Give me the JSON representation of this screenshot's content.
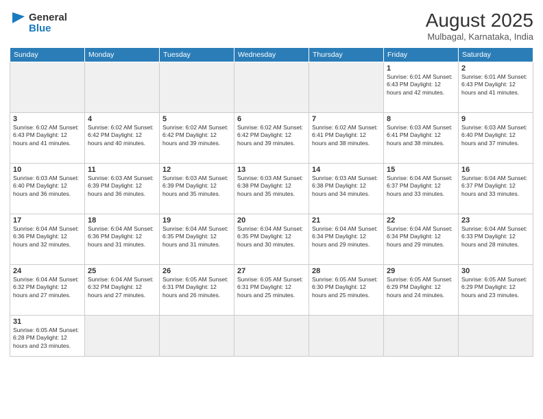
{
  "logo": {
    "text_general": "General",
    "text_blue": "Blue"
  },
  "title": {
    "month_year": "August 2025",
    "location": "Mulbagal, Karnataka, India"
  },
  "headers": [
    "Sunday",
    "Monday",
    "Tuesday",
    "Wednesday",
    "Thursday",
    "Friday",
    "Saturday"
  ],
  "weeks": [
    [
      {
        "day": "",
        "info": ""
      },
      {
        "day": "",
        "info": ""
      },
      {
        "day": "",
        "info": ""
      },
      {
        "day": "",
        "info": ""
      },
      {
        "day": "",
        "info": ""
      },
      {
        "day": "1",
        "info": "Sunrise: 6:01 AM\nSunset: 6:43 PM\nDaylight: 12 hours and 42 minutes."
      },
      {
        "day": "2",
        "info": "Sunrise: 6:01 AM\nSunset: 6:43 PM\nDaylight: 12 hours and 41 minutes."
      }
    ],
    [
      {
        "day": "3",
        "info": "Sunrise: 6:02 AM\nSunset: 6:43 PM\nDaylight: 12 hours and 41 minutes."
      },
      {
        "day": "4",
        "info": "Sunrise: 6:02 AM\nSunset: 6:42 PM\nDaylight: 12 hours and 40 minutes."
      },
      {
        "day": "5",
        "info": "Sunrise: 6:02 AM\nSunset: 6:42 PM\nDaylight: 12 hours and 39 minutes."
      },
      {
        "day": "6",
        "info": "Sunrise: 6:02 AM\nSunset: 6:42 PM\nDaylight: 12 hours and 39 minutes."
      },
      {
        "day": "7",
        "info": "Sunrise: 6:02 AM\nSunset: 6:41 PM\nDaylight: 12 hours and 38 minutes."
      },
      {
        "day": "8",
        "info": "Sunrise: 6:03 AM\nSunset: 6:41 PM\nDaylight: 12 hours and 38 minutes."
      },
      {
        "day": "9",
        "info": "Sunrise: 6:03 AM\nSunset: 6:40 PM\nDaylight: 12 hours and 37 minutes."
      }
    ],
    [
      {
        "day": "10",
        "info": "Sunrise: 6:03 AM\nSunset: 6:40 PM\nDaylight: 12 hours and 36 minutes."
      },
      {
        "day": "11",
        "info": "Sunrise: 6:03 AM\nSunset: 6:39 PM\nDaylight: 12 hours and 36 minutes."
      },
      {
        "day": "12",
        "info": "Sunrise: 6:03 AM\nSunset: 6:39 PM\nDaylight: 12 hours and 35 minutes."
      },
      {
        "day": "13",
        "info": "Sunrise: 6:03 AM\nSunset: 6:38 PM\nDaylight: 12 hours and 35 minutes."
      },
      {
        "day": "14",
        "info": "Sunrise: 6:03 AM\nSunset: 6:38 PM\nDaylight: 12 hours and 34 minutes."
      },
      {
        "day": "15",
        "info": "Sunrise: 6:04 AM\nSunset: 6:37 PM\nDaylight: 12 hours and 33 minutes."
      },
      {
        "day": "16",
        "info": "Sunrise: 6:04 AM\nSunset: 6:37 PM\nDaylight: 12 hours and 33 minutes."
      }
    ],
    [
      {
        "day": "17",
        "info": "Sunrise: 6:04 AM\nSunset: 6:36 PM\nDaylight: 12 hours and 32 minutes."
      },
      {
        "day": "18",
        "info": "Sunrise: 6:04 AM\nSunset: 6:36 PM\nDaylight: 12 hours and 31 minutes."
      },
      {
        "day": "19",
        "info": "Sunrise: 6:04 AM\nSunset: 6:35 PM\nDaylight: 12 hours and 31 minutes."
      },
      {
        "day": "20",
        "info": "Sunrise: 6:04 AM\nSunset: 6:35 PM\nDaylight: 12 hours and 30 minutes."
      },
      {
        "day": "21",
        "info": "Sunrise: 6:04 AM\nSunset: 6:34 PM\nDaylight: 12 hours and 29 minutes."
      },
      {
        "day": "22",
        "info": "Sunrise: 6:04 AM\nSunset: 6:34 PM\nDaylight: 12 hours and 29 minutes."
      },
      {
        "day": "23",
        "info": "Sunrise: 6:04 AM\nSunset: 6:33 PM\nDaylight: 12 hours and 28 minutes."
      }
    ],
    [
      {
        "day": "24",
        "info": "Sunrise: 6:04 AM\nSunset: 6:32 PM\nDaylight: 12 hours and 27 minutes."
      },
      {
        "day": "25",
        "info": "Sunrise: 6:04 AM\nSunset: 6:32 PM\nDaylight: 12 hours and 27 minutes."
      },
      {
        "day": "26",
        "info": "Sunrise: 6:05 AM\nSunset: 6:31 PM\nDaylight: 12 hours and 26 minutes."
      },
      {
        "day": "27",
        "info": "Sunrise: 6:05 AM\nSunset: 6:31 PM\nDaylight: 12 hours and 25 minutes."
      },
      {
        "day": "28",
        "info": "Sunrise: 6:05 AM\nSunset: 6:30 PM\nDaylight: 12 hours and 25 minutes."
      },
      {
        "day": "29",
        "info": "Sunrise: 6:05 AM\nSunset: 6:29 PM\nDaylight: 12 hours and 24 minutes."
      },
      {
        "day": "30",
        "info": "Sunrise: 6:05 AM\nSunset: 6:29 PM\nDaylight: 12 hours and 23 minutes."
      }
    ],
    [
      {
        "day": "31",
        "info": "Sunrise: 6:05 AM\nSunset: 6:28 PM\nDaylight: 12 hours and 23 minutes."
      },
      {
        "day": "",
        "info": ""
      },
      {
        "day": "",
        "info": ""
      },
      {
        "day": "",
        "info": ""
      },
      {
        "day": "",
        "info": ""
      },
      {
        "day": "",
        "info": ""
      },
      {
        "day": "",
        "info": ""
      }
    ]
  ]
}
